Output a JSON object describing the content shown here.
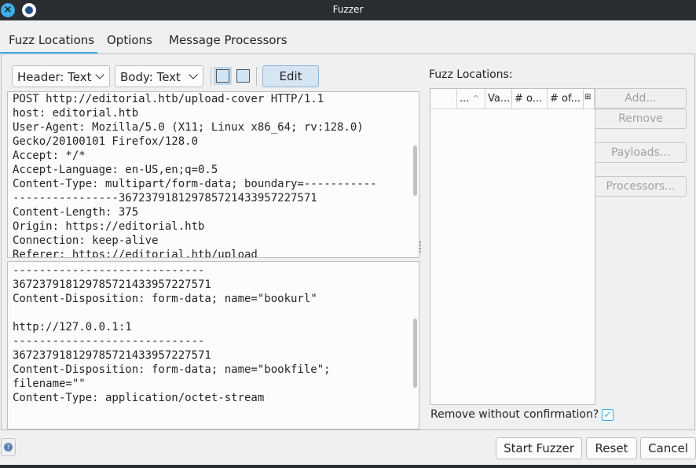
{
  "window": {
    "title": "Fuzzer"
  },
  "tabs": [
    {
      "label": "Fuzz Locations"
    },
    {
      "label": "Options"
    },
    {
      "label": "Message Processors"
    }
  ],
  "toolbar": {
    "header_view": "Header: Text",
    "body_view": "Body: Text",
    "edit_label": "Edit"
  },
  "header_lines": [
    "POST http://editorial.htb/upload-cover HTTP/1.1",
    "host: editorial.htb",
    "User-Agent: Mozilla/5.0 (X11; Linux x86_64; rv:128.0)",
    "Gecko/20100101 Firefox/128.0",
    "Accept: */*",
    "Accept-Language: en-US,en;q=0.5",
    "Content-Type: multipart/form-data; boundary=-----------",
    "----------------367237918129785721433957227571",
    "Content-Length: 375",
    "Origin: https://editorial.htb",
    "Connection: keep-alive",
    "Referer: https://editorial.htb/upload"
  ],
  "body_lines": [
    "-----------------------------",
    "367237918129785721433957227571",
    "Content-Disposition: form-data; name=\"bookurl\"",
    "",
    "http://127.0.0.1:1",
    "-----------------------------",
    "367237918129785721433957227571",
    "Content-Disposition: form-data; name=\"bookfile\";",
    "filename=\"\"",
    "Content-Type: application/octet-stream"
  ],
  "locations": {
    "label": "Fuzz Locations:",
    "columns": [
      "...",
      "Va...",
      "# o...",
      "# of..."
    ],
    "buttons": {
      "add": "Add...",
      "remove": "Remove",
      "payloads": "Payloads...",
      "processors": "Processors..."
    },
    "remove_confirm_label": "Remove without confirmation?",
    "remove_confirm_checked": true
  },
  "footer": {
    "start": "Start Fuzzer",
    "reset": "Reset",
    "cancel": "Cancel"
  }
}
